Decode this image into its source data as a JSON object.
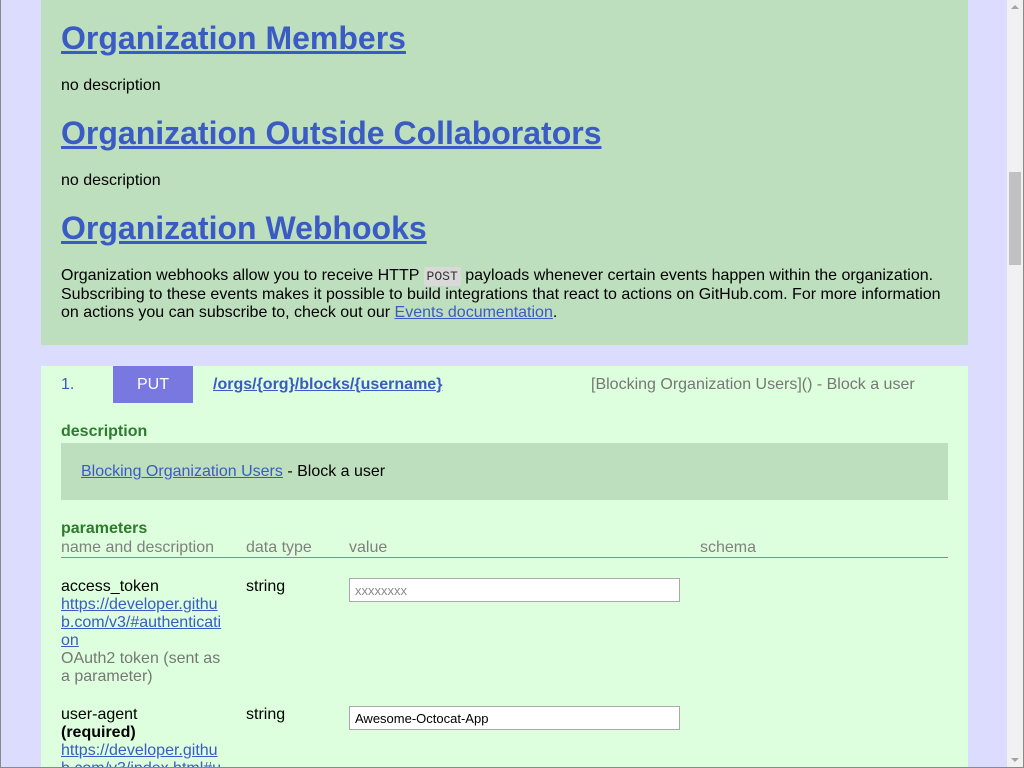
{
  "colors": {
    "page_bg": "#dcdcff",
    "group_bg": "#bedfbe",
    "operation_bg": "#ddffdd",
    "description_box_bg": "#bedfbe",
    "link": "#3a5bc4",
    "method_put_bg": "#7878e0",
    "label_green": "#2e7a2e",
    "muted_text": "#777777"
  },
  "groups": [
    {
      "title": "Organization Members",
      "description": "no description"
    },
    {
      "title": "Organization Outside Collaborators",
      "description": "no description"
    },
    {
      "title": "Organization Webhooks",
      "description_parts": {
        "before_code": "Organization webhooks allow you to receive HTTP ",
        "code": "POST",
        "after_code": " payloads whenever certain events happen within the organization. Subscribing to these events makes it possible to build integrations that react to actions on GitHub.com. For more information on actions you can subscribe to, check out our ",
        "link_text": "Events documentation",
        "end": "."
      }
    }
  ],
  "operation": {
    "index": "1.",
    "method": "PUT",
    "path": "/orgs/{org}/blocks/{username}",
    "summary": "[Blocking Organization Users]() - Block a user",
    "description_label": "description",
    "description_link": "Blocking Organization Users",
    "description_text": " - Block a user",
    "parameters_label": "parameters",
    "columns": [
      "name and description",
      "data type",
      "value",
      "schema"
    ],
    "params": [
      {
        "name": "access_token",
        "link": "https://developer.github.com/v3/#authentication",
        "description": "OAuth2 token (sent as a parameter)",
        "data_type": "string",
        "placeholder": "xxxxxxxx"
      },
      {
        "name": "user-agent",
        "required": "(required)",
        "link": "https://developer.github.com/v3/index.html#u",
        "data_type": "string",
        "value": "Awesome-Octocat-App"
      }
    ]
  }
}
